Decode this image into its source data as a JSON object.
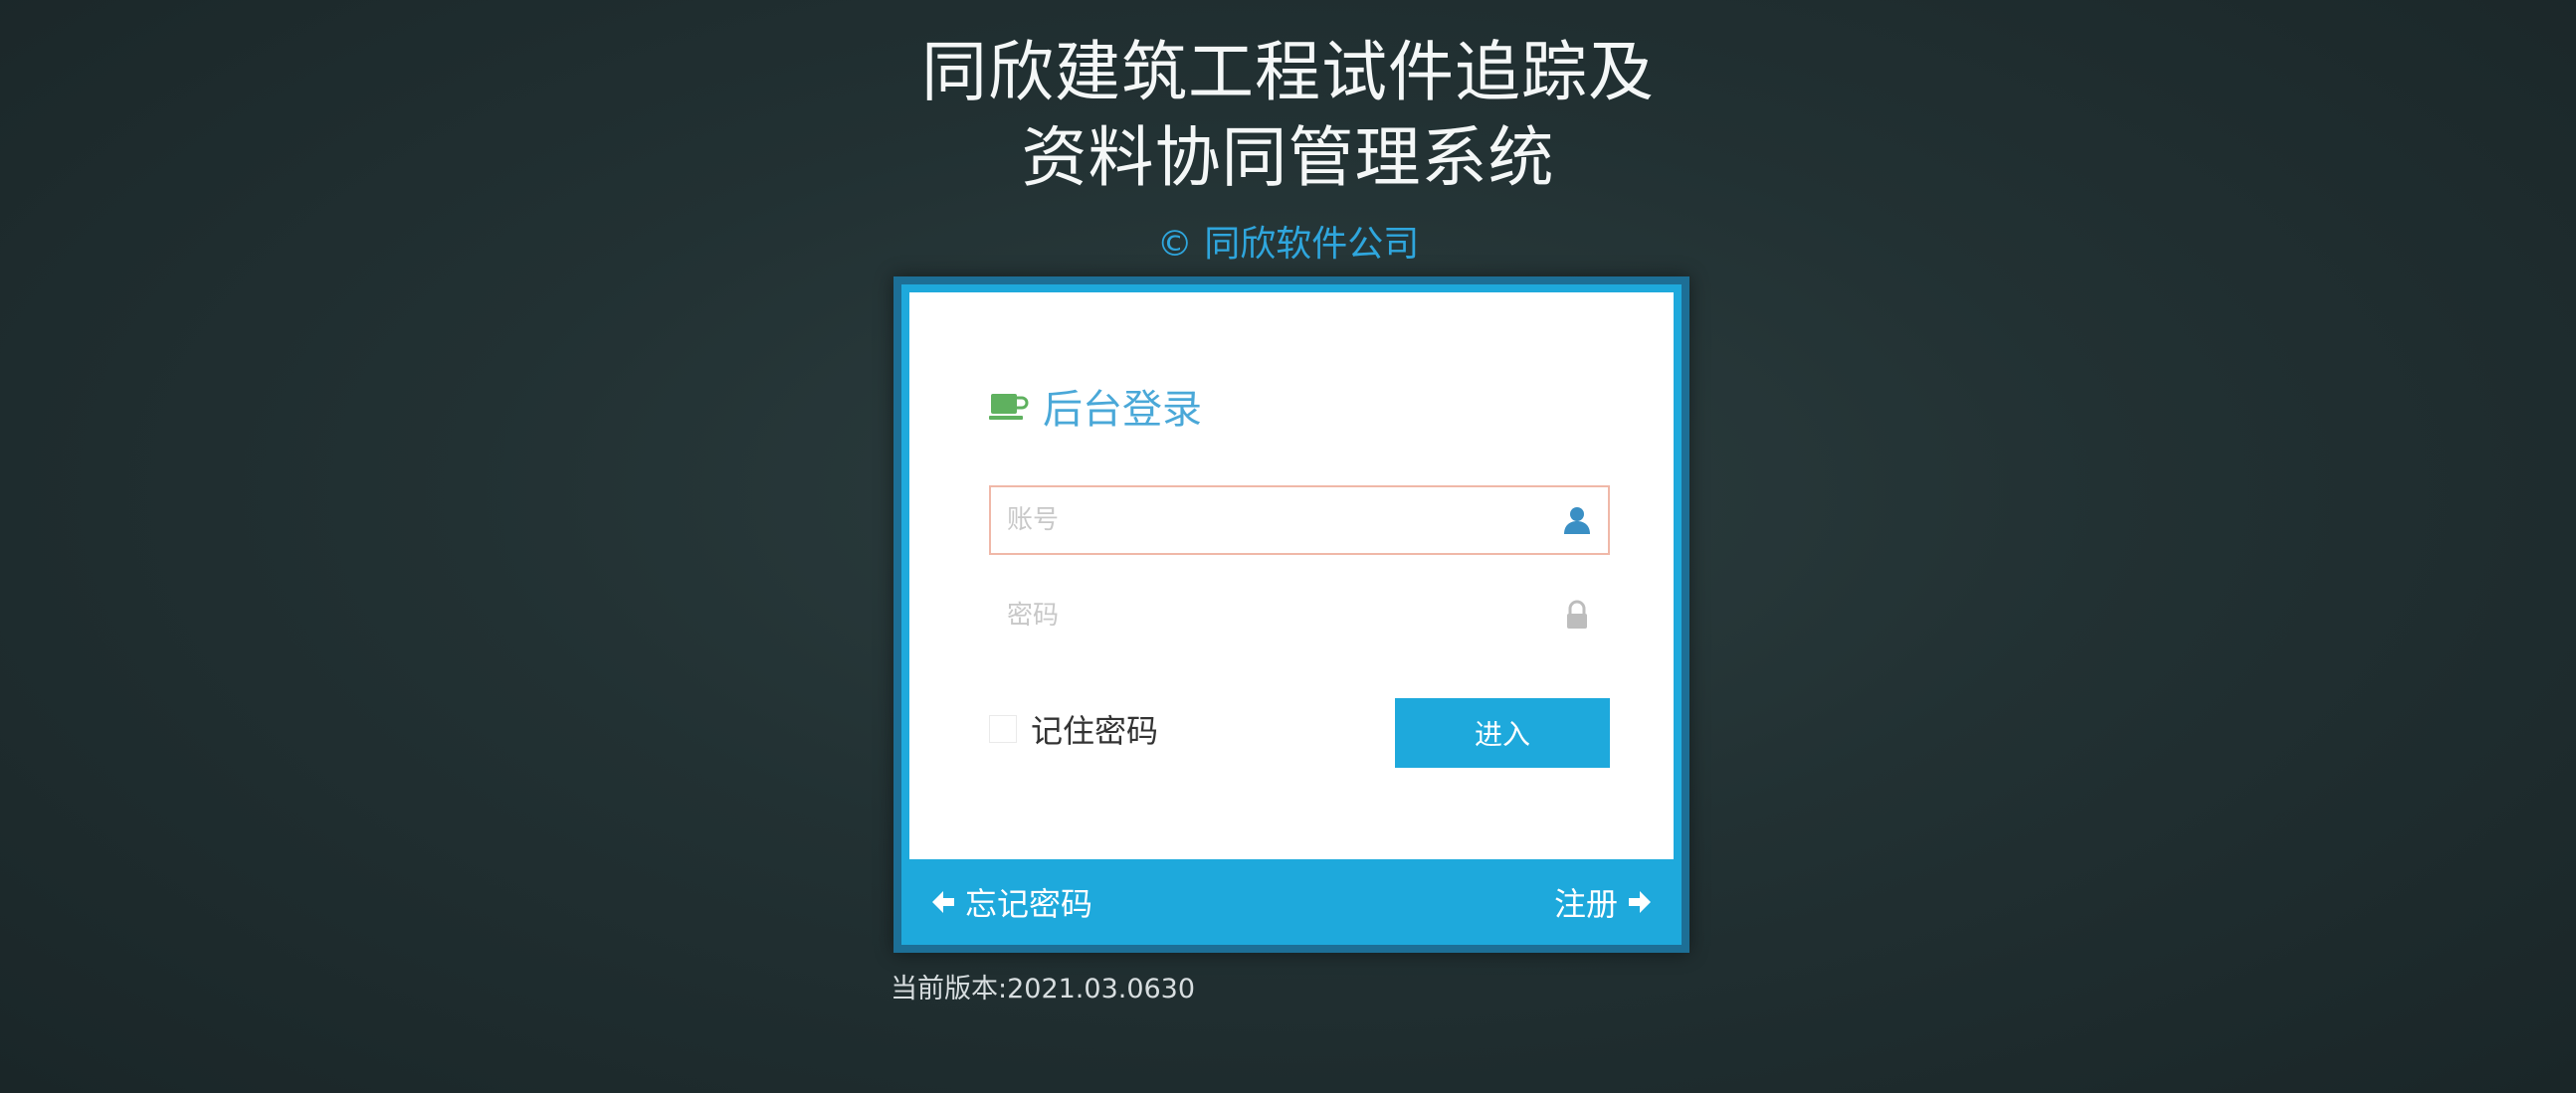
{
  "header": {
    "title_line1": "同欣建筑工程试件追踪及",
    "title_line2": "资料协同管理系统",
    "copyright": "© 同欣软件公司"
  },
  "login": {
    "heading": "后台登录",
    "heading_icon": "coffee-cup-icon",
    "username": {
      "value": "",
      "placeholder": "账号",
      "icon": "user-icon"
    },
    "password": {
      "value": "",
      "placeholder": "密码",
      "icon": "lock-icon"
    },
    "remember_label": "记住密码",
    "remember_checked": false,
    "submit_label": "进入"
  },
  "toolbar": {
    "forgot_label": "忘记密码",
    "register_label": "注册"
  },
  "version": "当前版本:2021.03.0630",
  "colors": {
    "accent": "#1ea9dc",
    "box_border": "#1d6f96",
    "heading": "#4aa8d8",
    "icon_green": "#5fb15f",
    "background": "#223133"
  }
}
